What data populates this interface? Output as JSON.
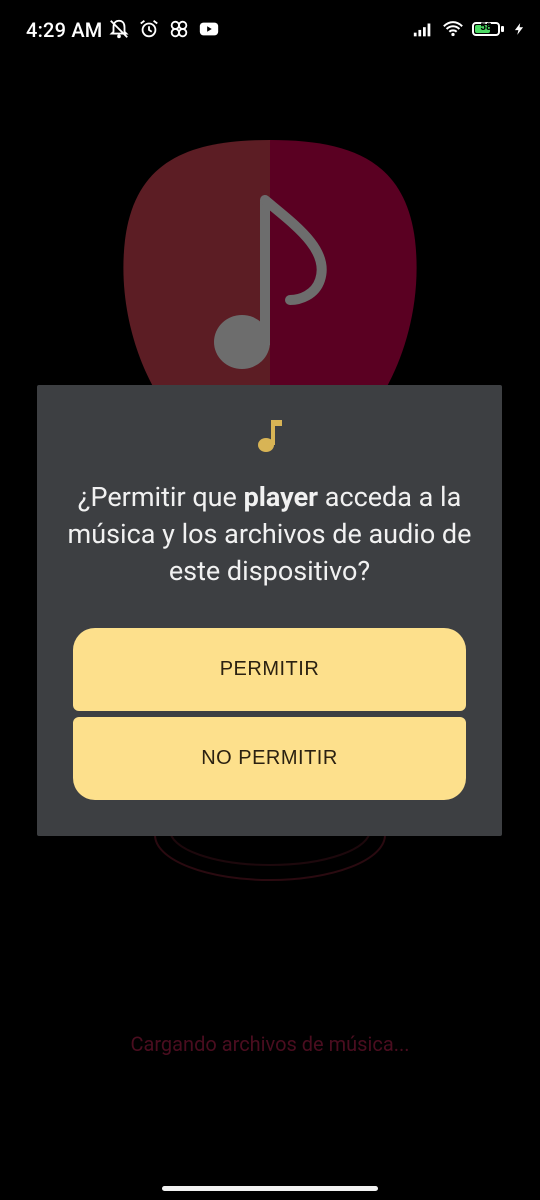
{
  "status_bar": {
    "time": "4:29 AM",
    "left_icons": [
      "notifications-off-icon",
      "alarm-icon",
      "pinwheel-icon",
      "youtube-icon"
    ],
    "right_icons": [
      "signal-icon",
      "wifi-icon",
      "battery-icon",
      "charging-icon"
    ],
    "battery_level": "58"
  },
  "app": {
    "loading_text": "Cargando archivos de música...",
    "logo_colors": {
      "left": "#5c1d24",
      "right": "#5a0022",
      "note": "#6d6d6d"
    }
  },
  "dialog": {
    "icon": "music-note-icon",
    "title_prefix": "¿Permitir que ",
    "title_app": "player",
    "title_suffix": " acceda a la música y los archivos de audio de este dispositivo?",
    "allow_label": "PERMITIR",
    "deny_label": "NO PERMITIR",
    "accent": "#fde08c",
    "icon_color": "#d8b455"
  }
}
